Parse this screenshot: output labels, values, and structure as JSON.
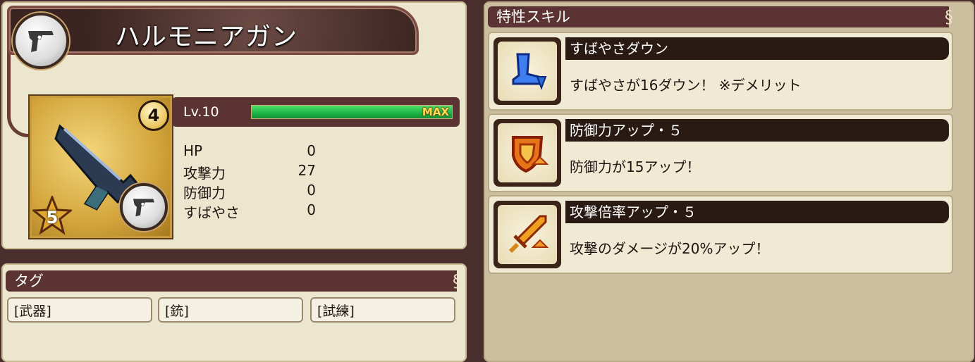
{
  "item": {
    "name": "ハルモニアガン",
    "rarity_number": "4",
    "star_count": "5",
    "icon": "handgun-icon"
  },
  "level": {
    "label": "Lv.10",
    "max_label": "MAX",
    "progress": 1.0
  },
  "stats": [
    {
      "name": "HP",
      "value": "0"
    },
    {
      "name": "攻撃力",
      "value": "27"
    },
    {
      "name": "防御力",
      "value": "0"
    },
    {
      "name": "すばやさ",
      "value": "0"
    }
  ],
  "tags": {
    "header": "タグ",
    "items": [
      "[武器]",
      "[銃]",
      "[試練]"
    ]
  },
  "skills": {
    "header": "特性スキル",
    "items": [
      {
        "name": "すばやさダウン",
        "desc": "すばやさが16ダウン！ ※デメリット",
        "icon": "boot-down-icon"
      },
      {
        "name": "防御力アップ・５",
        "desc": "防御力が15アップ！",
        "icon": "shield-up-icon"
      },
      {
        "name": "攻撃倍率アップ・５",
        "desc": "攻撃のダメージが20%アップ！",
        "icon": "sword-up-icon"
      }
    ]
  },
  "colors": {
    "panel": "#ece6cf",
    "header": "#5a3332",
    "exp_bar": "#1bb446",
    "background": "#4a2e2e"
  }
}
